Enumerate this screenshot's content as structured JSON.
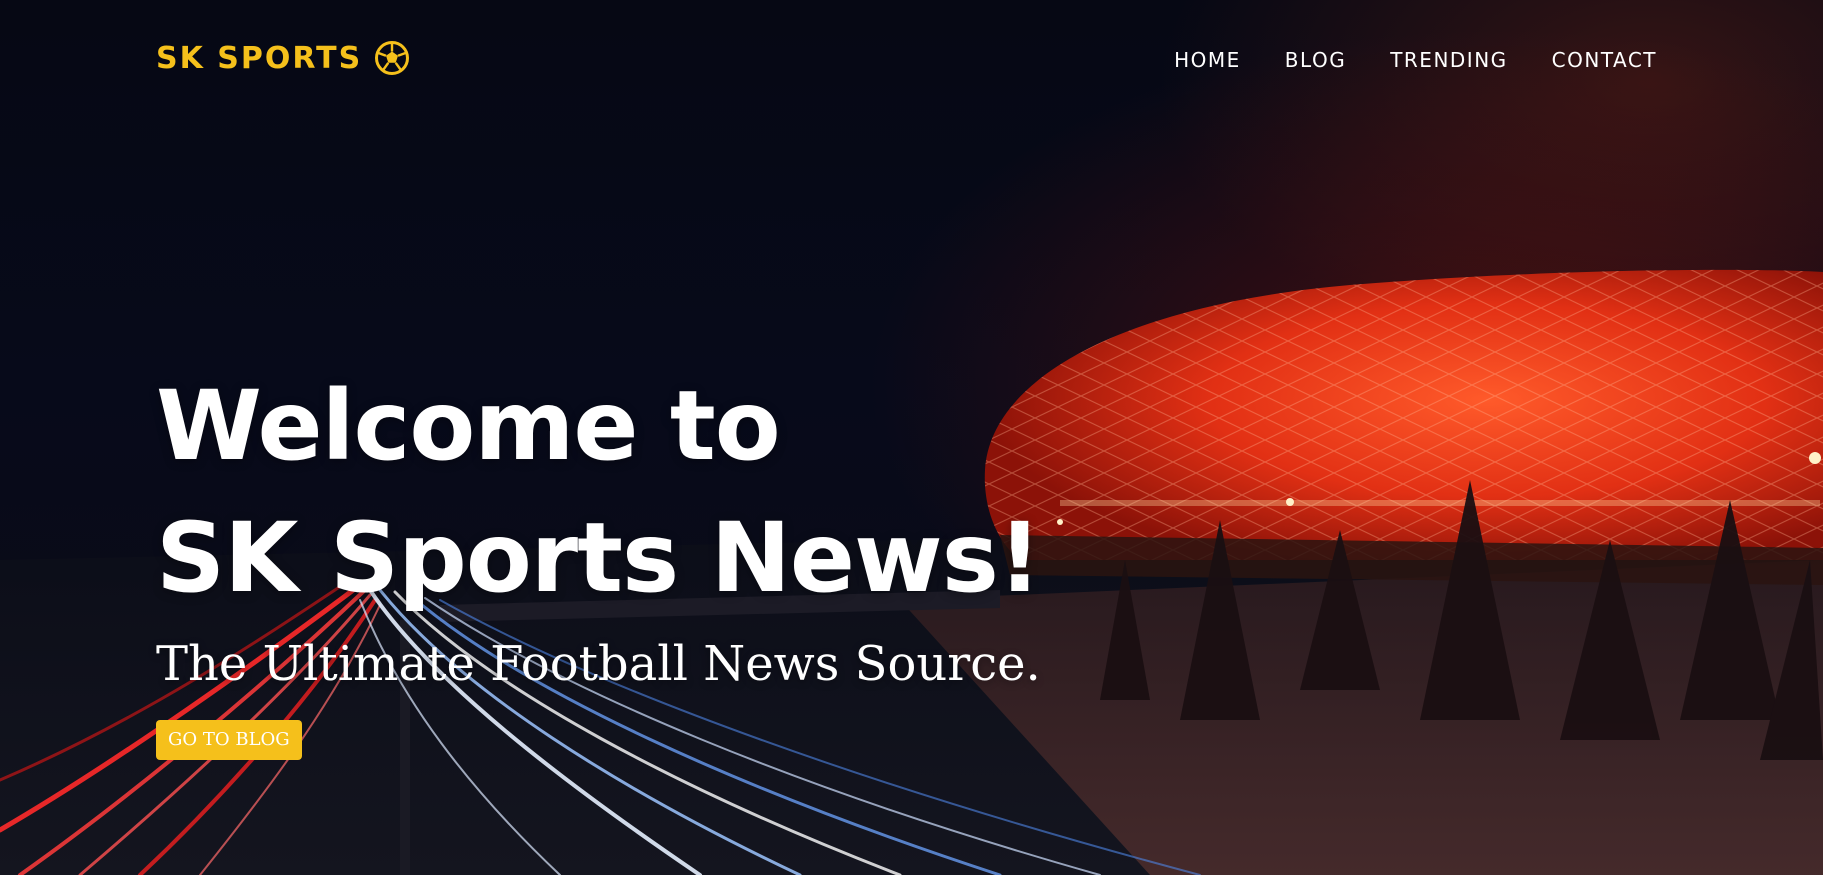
{
  "brand": {
    "name": "SK SPORTS",
    "accent_color": "#f5c01b",
    "icon": "soccer-ball-icon"
  },
  "nav": {
    "items": [
      "HOME",
      "BLOG",
      "TRENDING",
      "CONTACT"
    ]
  },
  "hero": {
    "headline_line1": "Welcome to",
    "headline_line2": "SK Sports News!",
    "tagline": "The Ultimate Football News Source.",
    "cta_label": "GO TO BLOG",
    "background": "night stadium with red lit facade and highway light trails"
  }
}
